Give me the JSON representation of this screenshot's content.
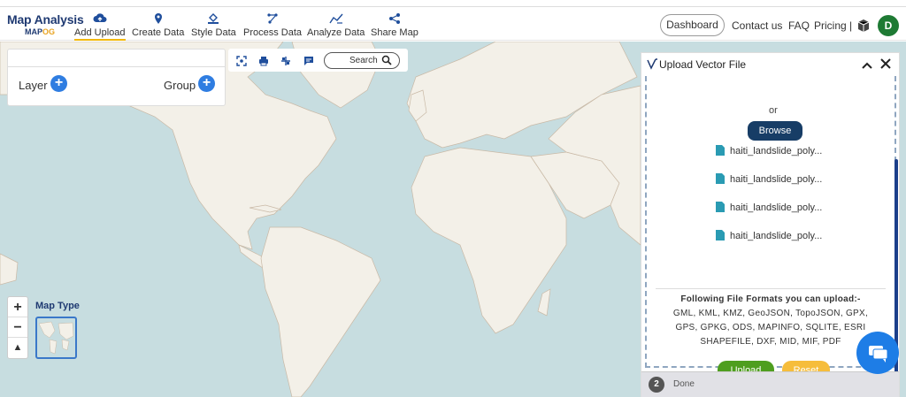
{
  "brand": {
    "line1": "Map Analysis",
    "line2_a": "MAP",
    "line2_b": "O",
    "line2_c": "G"
  },
  "nav": [
    {
      "label": "Add Upload",
      "icon": "cloud-upload-icon"
    },
    {
      "label": "Create Data",
      "icon": "map-pin-icon"
    },
    {
      "label": "Style Data",
      "icon": "paint-bucket-icon"
    },
    {
      "label": "Process Data",
      "icon": "process-icon"
    },
    {
      "label": "Analyze Data",
      "icon": "analyze-icon"
    },
    {
      "label": "Share Map",
      "icon": "share-icon"
    }
  ],
  "header_right": {
    "dashboard": "Dashboard",
    "contact": "Contact us",
    "faq": "FAQ",
    "pricing": "Pricing |",
    "avatar": "D"
  },
  "layer_panel": {
    "layer": "Layer",
    "group": "Group"
  },
  "toolbar": {
    "search": "Search"
  },
  "map_type": {
    "label": "Map Type"
  },
  "zoom": {
    "in": "+",
    "out": "−",
    "reset": "▲"
  },
  "upload": {
    "title": "Upload Vector File",
    "or": "or",
    "browse": "Browse",
    "files": [
      "haiti_landslide_poly...",
      "haiti_landslide_poly...",
      "haiti_landslide_poly...",
      "haiti_landslide_poly..."
    ],
    "formats_title": "Following File Formats you can upload:-",
    "formats_lines": [
      "GML, KML, KMZ, GeoJSON, TopoJSON, GPX,",
      "GPS, GPKG, ODS, MAPINFO, SQLITE, ESRI",
      "SHAPEFILE, DXF, MID, MIF, PDF"
    ],
    "upload_btn": "Upload",
    "reset_btn": "Reset",
    "done_num": "2",
    "done_label": "Done"
  },
  "colors": {
    "brand": "#1f3a72",
    "accent": "#2f7de1",
    "browse": "#173d66",
    "upload": "#4e9e1f",
    "reset": "#f6bd3b",
    "sea": "#c7dde0",
    "land": "#f3f0e8"
  }
}
